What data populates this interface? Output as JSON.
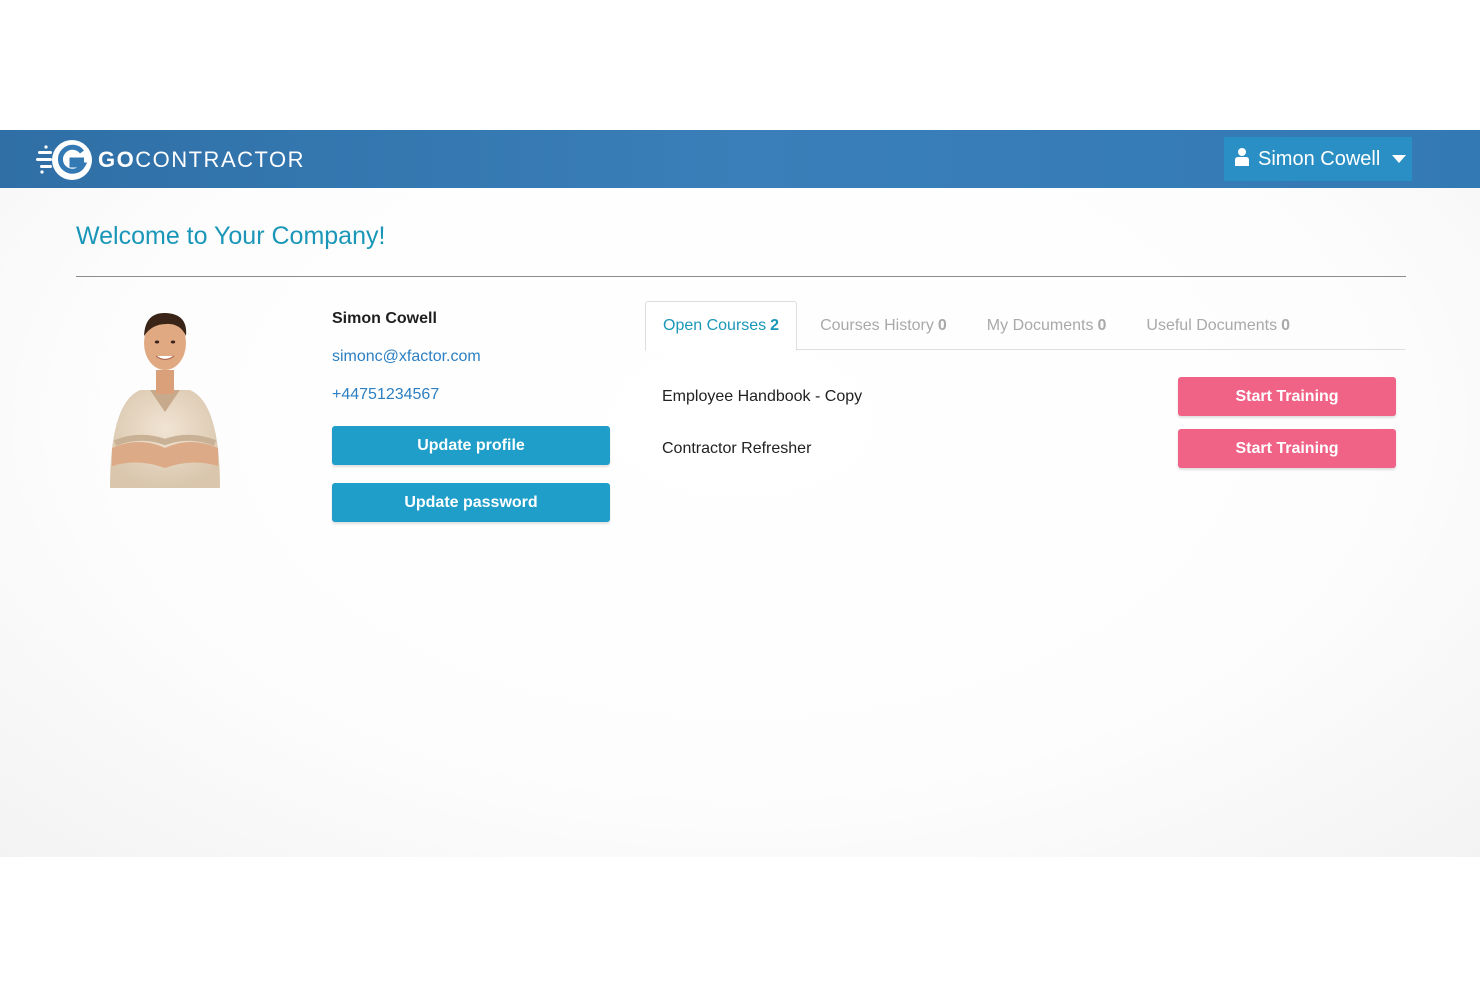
{
  "header": {
    "logo_go": "GO",
    "logo_rest": "CONTRACTOR",
    "user_name": "Simon Cowell"
  },
  "page": {
    "title": "Welcome to Your Company!"
  },
  "profile": {
    "name": "Simon Cowell",
    "email": "simonc@xfactor.com",
    "phone": "+44751234567",
    "update_profile_label": "Update profile",
    "update_password_label": "Update password"
  },
  "tabs": [
    {
      "label": "Open Courses",
      "count": "2"
    },
    {
      "label": "Courses History",
      "count": "0"
    },
    {
      "label": "My Documents",
      "count": "0"
    },
    {
      "label": "Useful Documents",
      "count": "0"
    }
  ],
  "courses": [
    {
      "name": "Employee Handbook - Copy",
      "action": "Start Training"
    },
    {
      "name": "Contractor Refresher",
      "action": "Start Training"
    }
  ],
  "colors": {
    "navbar": "#3379b4",
    "accent": "#1a97b8",
    "button_blue": "#1f9ec9",
    "button_pink": "#f06286",
    "link": "#2b7fc2"
  },
  "icons": {
    "logo": "g-speed-logo-icon",
    "user": "user-icon",
    "caret": "caret-down-icon"
  }
}
